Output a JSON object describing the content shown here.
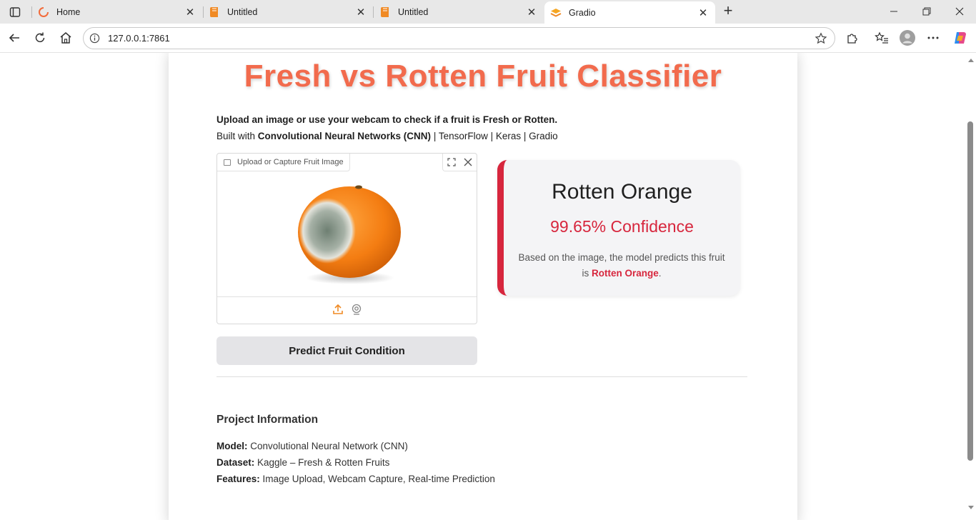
{
  "browser": {
    "tabs": [
      {
        "title": "Home",
        "favicon": "loading-spinner-icon"
      },
      {
        "title": "Untitled",
        "favicon": "book-icon"
      },
      {
        "title": "Untitled",
        "favicon": "book-icon"
      },
      {
        "title": "Gradio",
        "favicon": "gradio-icon",
        "active": true
      }
    ],
    "url": "127.0.0.1:7861"
  },
  "app": {
    "title": "Fresh vs Rotten Fruit Classifier",
    "intro_bold": "Upload an image or use your webcam to check if a fruit is Fresh or Rotten.",
    "built_prefix": "Built with ",
    "built_bold": "Convolutional Neural Networks (CNN)",
    "built_suffix": " | TensorFlow | Keras | Gradio",
    "image_input_label": "Upload or Capture Fruit Image",
    "predict_button": "Predict Fruit Condition"
  },
  "result": {
    "label": "Rotten Orange",
    "confidence": "99.65% Confidence",
    "note_prefix": "Based on the image, the model predicts this fruit is ",
    "note_highlight": "Rotten Orange",
    "note_suffix": ".",
    "accent_color": "#d7263d"
  },
  "project": {
    "heading": "Project Information",
    "model_key": "Model:",
    "model_value": " Convolutional Neural Network (CNN)",
    "dataset_key": "Dataset:",
    "dataset_value": " Kaggle – Fresh & Rotten Fruits",
    "features_key": "Features:",
    "features_value": " Image Upload, Webcam Capture, Real-time Prediction"
  },
  "colors": {
    "title": "#f26b4d",
    "upload_icon": "#f08a24"
  }
}
